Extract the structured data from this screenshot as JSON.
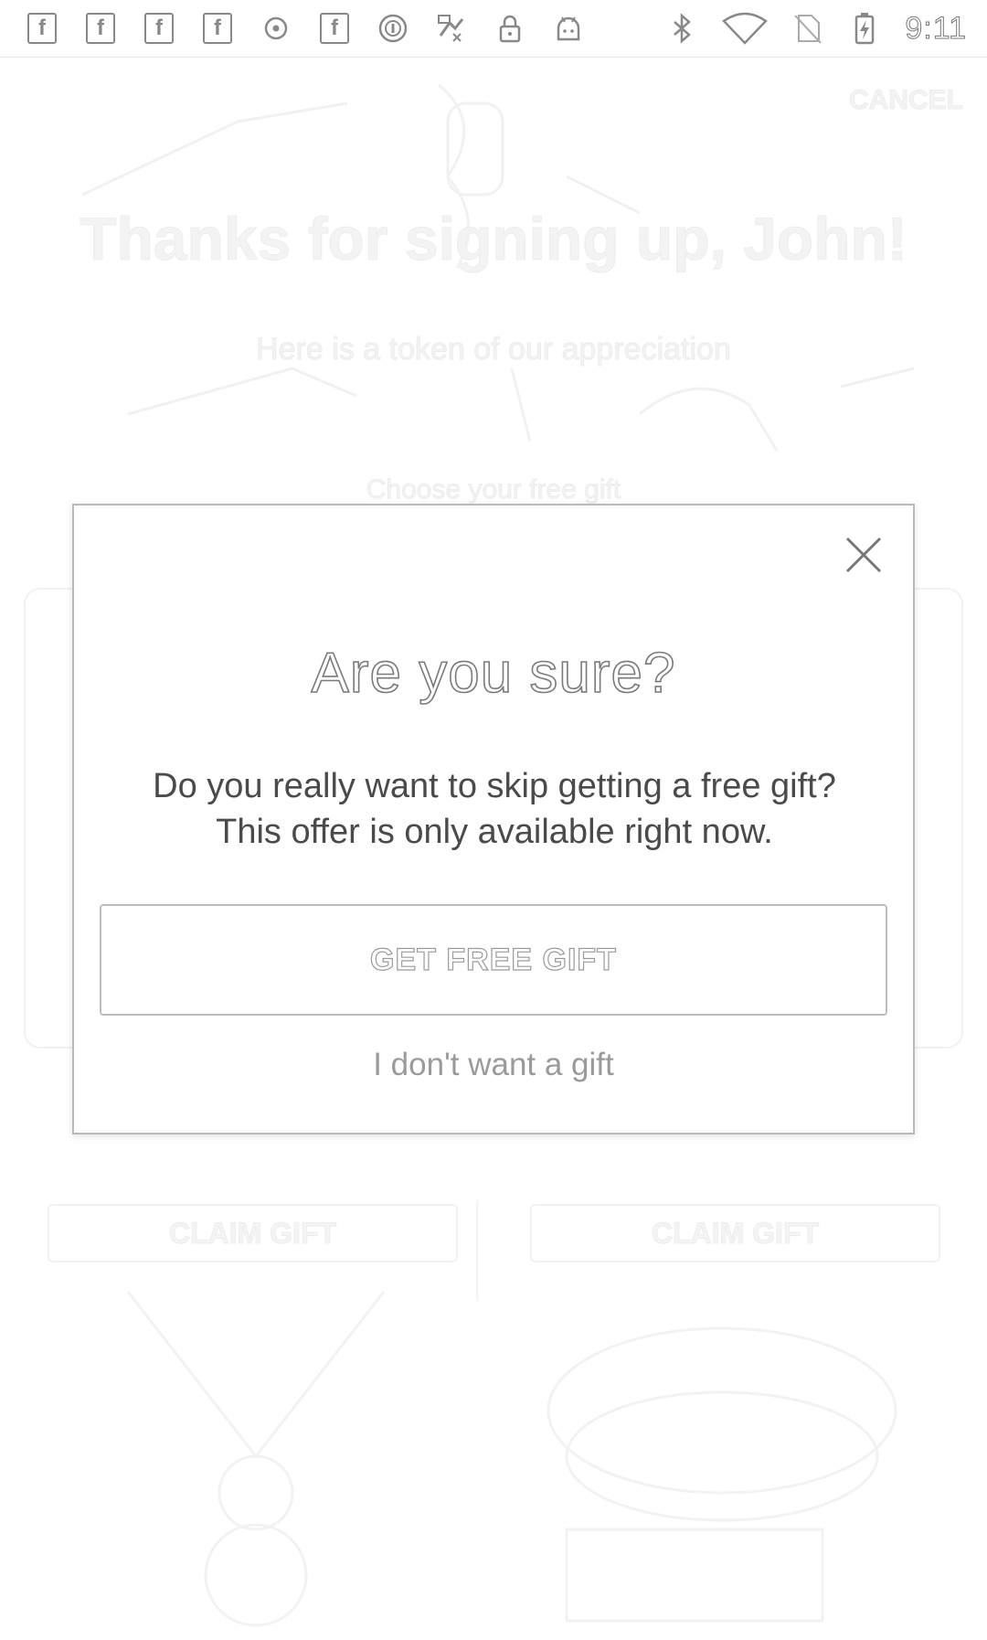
{
  "status_bar": {
    "time": "9:11",
    "left_icons": [
      "facebook-icon",
      "facebook-icon",
      "facebook-icon",
      "facebook-icon",
      "circle-dot-icon",
      "facebook-icon",
      "circle-info-icon",
      "fax-icon",
      "lock-icon",
      "android-icon"
    ],
    "right_icons": [
      "bluetooth-icon",
      "wifi-icon",
      "no-sim-icon",
      "battery-charging-icon"
    ]
  },
  "background_page": {
    "top_link": "CANCEL",
    "headline": "Thanks for signing up, John!",
    "subline": "Here is a token of our appreciation",
    "section_label": "Choose your free gift",
    "claim_left": "CLAIM GIFT",
    "claim_right": "CLAIM GIFT"
  },
  "dialog": {
    "title": "Are you sure?",
    "message": "Do you really want to skip getting a free gift? This offer is only available right now.",
    "primary_button": "GET FREE GIFT",
    "decline_link": "I don't want a gift",
    "close_icon": "close-icon"
  }
}
